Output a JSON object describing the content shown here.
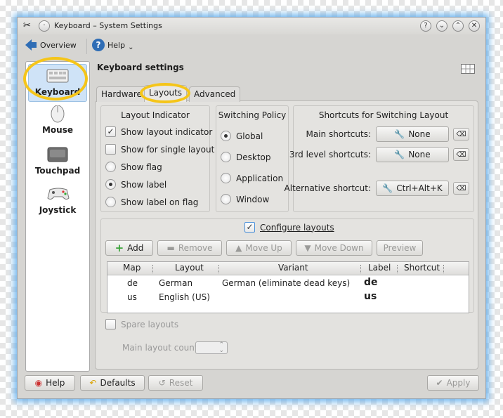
{
  "window": {
    "title": "Keyboard – System Settings",
    "controls": [
      "?",
      "⌄",
      "⌃",
      "✕"
    ]
  },
  "toolbar": {
    "overview": "Overview",
    "help": "Help"
  },
  "sidebar": {
    "items": [
      {
        "label": "Keyboard",
        "icon": "keyboard-icon"
      },
      {
        "label": "Mouse",
        "icon": "mouse-icon"
      },
      {
        "label": "Touchpad",
        "icon": "touchpad-icon"
      },
      {
        "label": "Joystick",
        "icon": "joystick-icon"
      }
    ]
  },
  "header": {
    "title": "Keyboard settings"
  },
  "tabs": [
    "Hardware",
    "Layouts",
    "Advanced"
  ],
  "layout_indicator": {
    "title": "Layout Indicator",
    "options": [
      {
        "label": "Show layout indicator",
        "type": "checkbox",
        "checked": true
      },
      {
        "label": "Show for single layout",
        "type": "checkbox",
        "checked": false
      },
      {
        "label": "Show flag",
        "type": "radio",
        "checked": false
      },
      {
        "label": "Show label",
        "type": "radio",
        "checked": true
      },
      {
        "label": "Show label on flag",
        "type": "radio",
        "checked": false
      }
    ]
  },
  "switching_policy": {
    "title": "Switching Policy",
    "options": [
      {
        "label": "Global",
        "checked": true
      },
      {
        "label": "Desktop",
        "checked": false
      },
      {
        "label": "Application",
        "checked": false
      },
      {
        "label": "Window",
        "checked": false
      }
    ]
  },
  "shortcuts": {
    "title": "Shortcuts for Switching Layout",
    "rows": [
      {
        "label": "Main shortcuts:",
        "value": "None"
      },
      {
        "label": "3rd level shortcuts:",
        "value": "None"
      },
      {
        "label": "Alternative shortcut:",
        "value": "Ctrl+Alt+K"
      }
    ]
  },
  "configure": {
    "label": "Configure layouts",
    "checked": true,
    "buttons": [
      {
        "label": "Add",
        "enabled": true
      },
      {
        "label": "Remove",
        "enabled": false
      },
      {
        "label": "Move Up",
        "enabled": false
      },
      {
        "label": "Move Down",
        "enabled": false
      },
      {
        "label": "Preview",
        "enabled": false
      }
    ],
    "columns": [
      "Map",
      "Layout",
      "Variant",
      "Label",
      "Shortcut"
    ],
    "rows": [
      {
        "map": "de",
        "layout": "German",
        "variant": "German (eliminate dead keys)",
        "label": "de",
        "shortcut": ""
      },
      {
        "map": "us",
        "layout": "English (US)",
        "variant": "",
        "label": "us",
        "shortcut": ""
      }
    ]
  },
  "spare": {
    "label": "Spare layouts",
    "checked": false,
    "count_label": "Main layout count:",
    "count_value": ""
  },
  "footer": {
    "help": "Help",
    "defaults": "Defaults",
    "reset": "Reset",
    "apply": "Apply"
  },
  "colors": {
    "highlight": "#f5c518",
    "selection": "#cfe3f7",
    "glow": "#5aaaeb",
    "add_green": "#3aa43a"
  }
}
